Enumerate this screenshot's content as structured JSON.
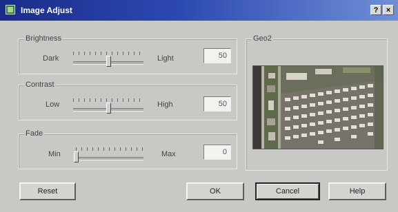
{
  "window": {
    "title": "Image Adjust",
    "help_glyph": "?",
    "close_glyph": "×",
    "icon": "image-app-icon"
  },
  "brightness": {
    "label": "Brightness",
    "min_label": "Dark",
    "max_label": "Light",
    "value": "50",
    "level": 0.5
  },
  "contrast": {
    "label": "Contrast",
    "min_label": "Low",
    "max_label": "High",
    "value": "50",
    "level": 0.5
  },
  "fade": {
    "label": "Fade",
    "min_label": "Min",
    "max_label": "Max",
    "value": "0",
    "level": 0.0
  },
  "preview": {
    "label": "Geo2"
  },
  "buttons": {
    "reset": "Reset",
    "ok": "OK",
    "cancel": "Cancel",
    "help": "Help"
  }
}
